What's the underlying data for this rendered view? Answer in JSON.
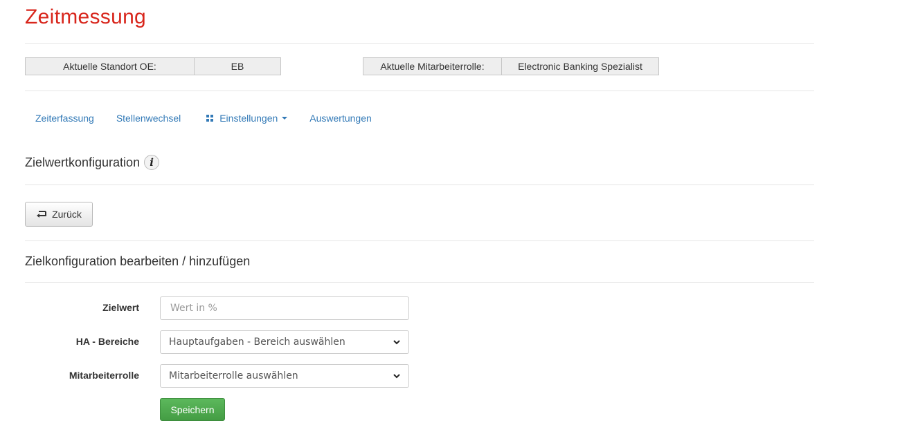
{
  "app": {
    "title": "Zeitmessung"
  },
  "status": {
    "location_label": "Aktuelle Standort OE:",
    "location_value": "EB",
    "role_label": "Aktuelle Mitarbeiterrolle:",
    "role_value": "Electronic Banking Spezialist"
  },
  "nav": {
    "items": [
      {
        "label": "Zeiterfassung"
      },
      {
        "label": "Stellenwechsel"
      },
      {
        "label": "Einstellungen",
        "icon": "grid-icon",
        "dropdown": true
      },
      {
        "label": "Auswertungen"
      }
    ]
  },
  "page": {
    "title": "Zielwertkonfiguration",
    "info_icon_glyph": "i",
    "back_label": "Zurück",
    "form_title": "Zielkonfiguration bearbeiten / hinzufügen"
  },
  "form": {
    "target_label": "Zielwert",
    "target_placeholder": "Wert in %",
    "target_value": "",
    "area_label": "HA - Bereiche",
    "area_selected": "Hauptaufgaben - Bereich auswählen",
    "role_label": "Mitarbeiterrolle",
    "role_selected": "Mitarbeiterrolle auswählen",
    "save_label": "Speichern"
  },
  "colors": {
    "brand": "#d8261c",
    "link": "#337ab7",
    "success": "#5cb85c"
  }
}
